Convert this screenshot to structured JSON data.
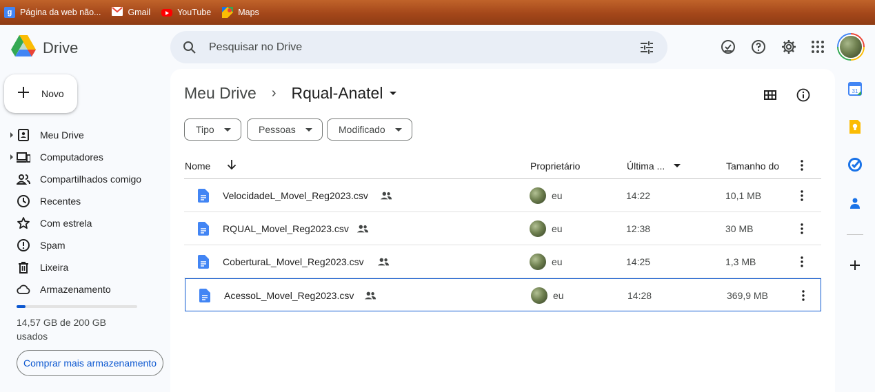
{
  "bookmarks": [
    {
      "label": "Página da web não...",
      "icon": "google-g-icon"
    },
    {
      "label": "Gmail",
      "icon": "gmail-icon"
    },
    {
      "label": "YouTube",
      "icon": "youtube-icon"
    },
    {
      "label": "Maps",
      "icon": "maps-icon"
    }
  ],
  "app": {
    "name": "Drive"
  },
  "search": {
    "placeholder": "Pesquisar no Drive"
  },
  "new_button": {
    "label": "Novo"
  },
  "nav": {
    "items": [
      {
        "label": "Meu Drive",
        "icon": "my-drive-icon"
      },
      {
        "label": "Computadores",
        "icon": "computers-icon"
      },
      {
        "label": "Compartilhados comigo",
        "icon": "shared-icon"
      },
      {
        "label": "Recentes",
        "icon": "clock-icon"
      },
      {
        "label": "Com estrela",
        "icon": "star-icon"
      },
      {
        "label": "Spam",
        "icon": "spam-icon"
      },
      {
        "label": "Lixeira",
        "icon": "trash-icon"
      },
      {
        "label": "Armazenamento",
        "icon": "cloud-icon"
      }
    ]
  },
  "storage": {
    "used_text": "14,57 GB de 200 GB usados",
    "used_fraction": 0.073,
    "buy_label": "Comprar mais armazenamento"
  },
  "breadcrumb": {
    "root": "Meu Drive",
    "current": "Rqual-Anatel"
  },
  "filters": [
    "Tipo",
    "Pessoas",
    "Modificado"
  ],
  "columns": {
    "name": "Nome",
    "owner": "Proprietário",
    "modified": "Última ...",
    "size": "Tamanho do"
  },
  "files": [
    {
      "name": "VelocidadeL_Movel_Reg2023.csv",
      "owner": "eu",
      "modified": "14:22",
      "size": "10,1 MB"
    },
    {
      "name": "RQUAL_Movel_Reg2023.csv",
      "owner": "eu",
      "modified": "12:38",
      "size": "30 MB"
    },
    {
      "name": "CoberturaL_Movel_Reg2023.csv",
      "owner": "eu",
      "modified": "14:25",
      "size": "1,3 MB"
    },
    {
      "name": "AcessoL_Movel_Reg2023.csv",
      "owner": "eu",
      "modified": "14:28",
      "size": "369,9 MB"
    }
  ],
  "colors": {
    "accent": "#0b57d0",
    "file_icon": "#4285f4",
    "bookmarks_bar": "#a4471a"
  }
}
